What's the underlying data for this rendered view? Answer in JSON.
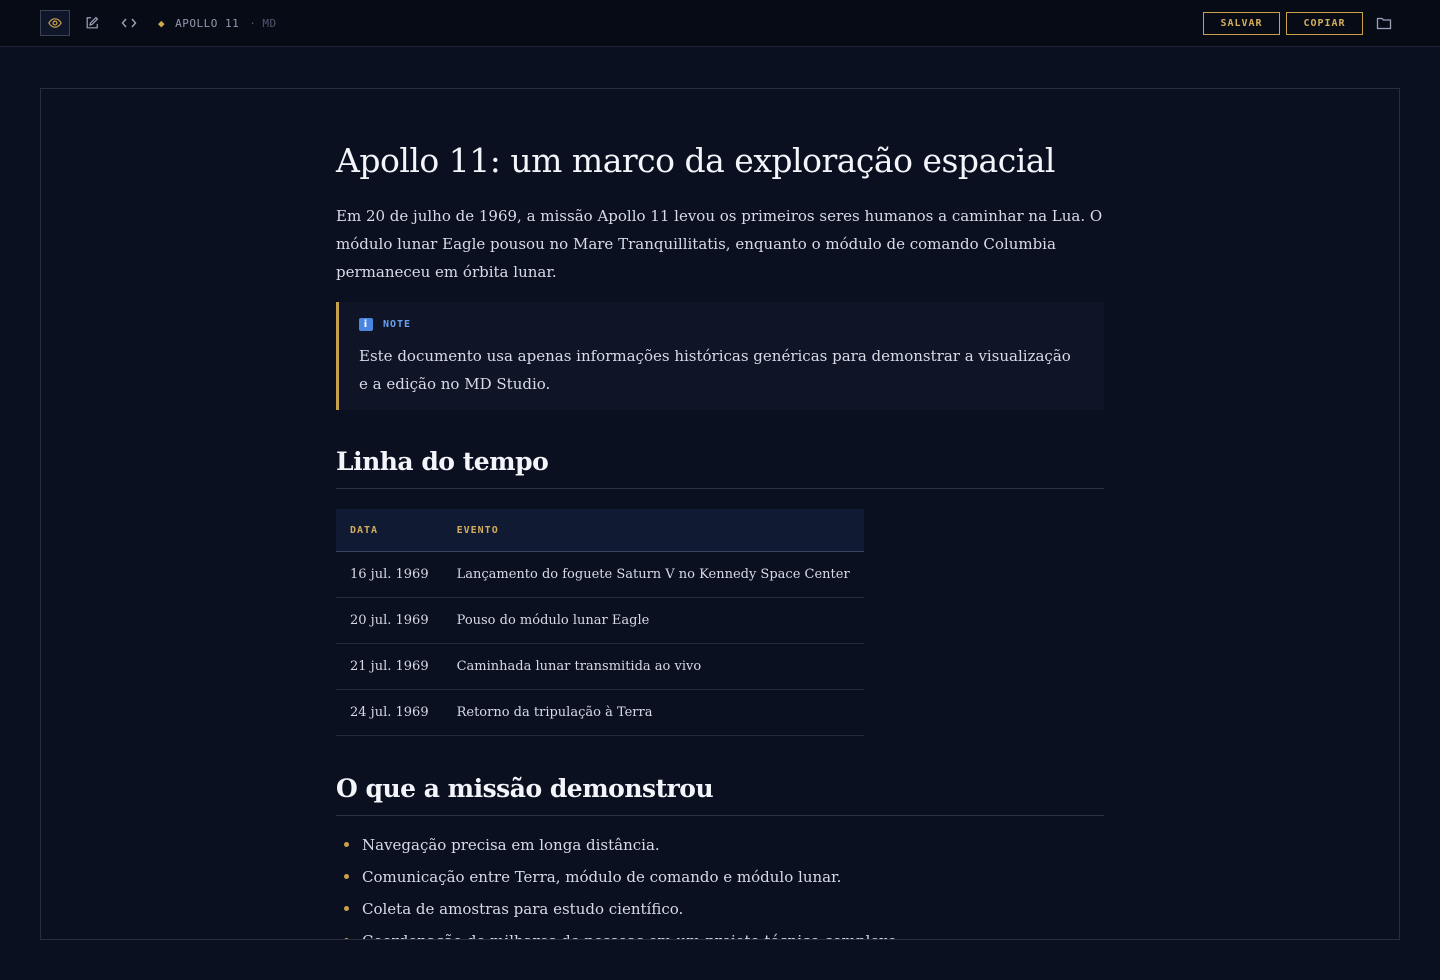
{
  "toolbar": {
    "preview_label": "preview",
    "edit_label": "edit",
    "code_label": "code",
    "doc_name": "APOLLO 11",
    "separator": "·",
    "doc_ext": "MD",
    "save_label": "SALVAR",
    "copy_label": "COPIAR",
    "icons": [
      "eye-icon",
      "edit-icon",
      "code-icon",
      "diamond-icon",
      "folder-icon"
    ]
  },
  "document": {
    "title": "Apollo 11: um marco da exploração espacial",
    "intro": "Em 20 de julho de 1969, a missão Apollo 11 levou os primeiros seres humanos a caminhar na Lua. O módulo lunar Eagle pousou no Mare Tranquillitatis, enquanto o módulo de comando Columbia permaneceu em órbita lunar.",
    "note": {
      "label": "NOTE",
      "icon": "info-icon",
      "text": "Este documento usa apenas informações históricas genéricas para demonstrar a visualização e a edição no MD Studio."
    },
    "timeline_heading": "Linha do tempo",
    "timeline": {
      "headers": [
        "DATA",
        "EVENTO"
      ],
      "rows": [
        {
          "date": "16 jul. 1969",
          "event": "Lançamento do foguete Saturn V no Kennedy Space Center"
        },
        {
          "date": "20 jul. 1969",
          "event": "Pouso do módulo lunar Eagle"
        },
        {
          "date": "21 jul. 1969",
          "event": "Caminhada lunar transmitida ao vivo"
        },
        {
          "date": "24 jul. 1969",
          "event": "Retorno da tripulação à Terra"
        }
      ]
    },
    "mission_heading": "O que a missão demonstrou",
    "points": [
      "Navegação precisa em longa distância.",
      "Comunicação entre Terra, módulo de comando e módulo lunar.",
      "Coleta de amostras para estudo científico.",
      "Coordenação de milhares de pessoas em um projeto técnico complexo."
    ]
  },
  "colors": {
    "background": "#0b1020",
    "accent": "#c9a14a",
    "note_accent": "#4a86e0"
  }
}
